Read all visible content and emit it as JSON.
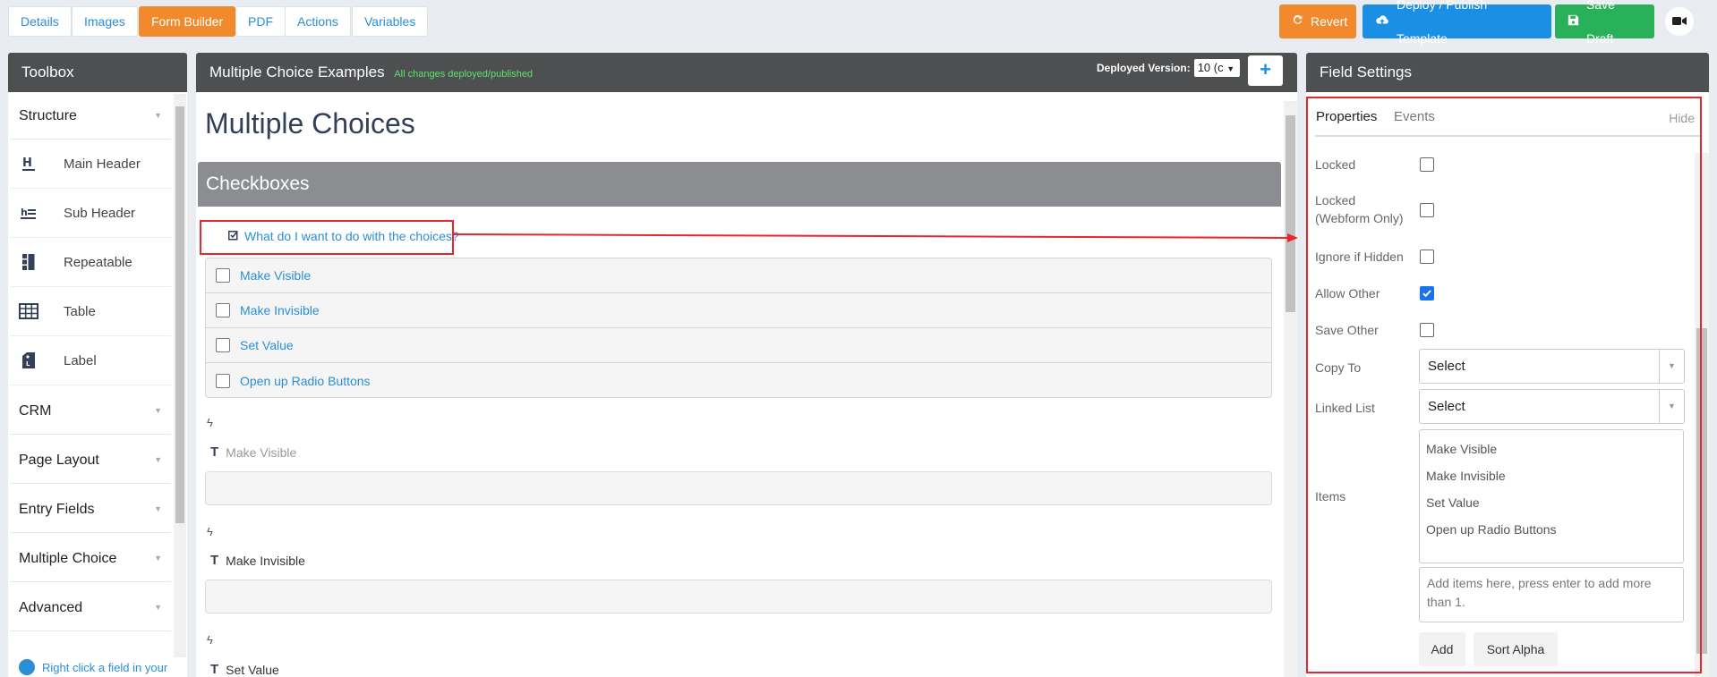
{
  "topbar": {
    "tabs": [
      "Details",
      "Images",
      "Form Builder",
      "PDF",
      "Actions",
      "Variables"
    ],
    "revert_label": "Revert",
    "deploy_label": "Deploy / Publish Template",
    "draft_label": "Save Draft"
  },
  "toolbox": {
    "title": "Toolbox",
    "sections": [
      "Structure",
      "CRM",
      "Page Layout",
      "Entry Fields",
      "Multiple Choice",
      "Advanced"
    ],
    "items": [
      "Main Header",
      "Sub Header",
      "Repeatable",
      "Table",
      "Label"
    ],
    "hint": "Right click a field in your"
  },
  "canvas": {
    "header_title": "Multiple Choice Examples",
    "header_status": "All changes deployed/published",
    "deployed_label": "Deployed Version:",
    "deployed_value": "10 (c",
    "form_title": "Multiple Choices",
    "section_title": "Checkboxes",
    "question": "What do I want to do with the choices?",
    "choices": [
      "Make Visible",
      "Make Invisible",
      "Set Value",
      "Open up Radio Buttons"
    ],
    "events": [
      "Make Visible",
      "Make Invisible",
      "Set Value"
    ]
  },
  "settings": {
    "title": "Field Settings",
    "tab_properties": "Properties",
    "tab_events": "Events",
    "hide": "Hide",
    "labels": {
      "locked": "Locked",
      "locked_web": "Locked (Webform Only)",
      "ignore_hidden": "Ignore if Hidden",
      "allow_other": "Allow Other",
      "save_other": "Save Other",
      "copy_to": "Copy To",
      "linked_list": "Linked List",
      "items": "Items"
    },
    "copy_to_value": "Select",
    "linked_list_value": "Select",
    "items": [
      "Make Visible",
      "Make Invisible",
      "Set Value",
      "Open up Radio Buttons"
    ],
    "add_placeholder": "Add items here, press enter to add more than 1.",
    "add_label": "Add",
    "sort_label": "Sort Alpha",
    "allow_other_checked": true
  },
  "colors": {
    "accent_orange": "#f28a2d",
    "accent_blue": "#1a8fe3",
    "accent_green": "#28b159",
    "annotation_red": "#e8262c"
  }
}
